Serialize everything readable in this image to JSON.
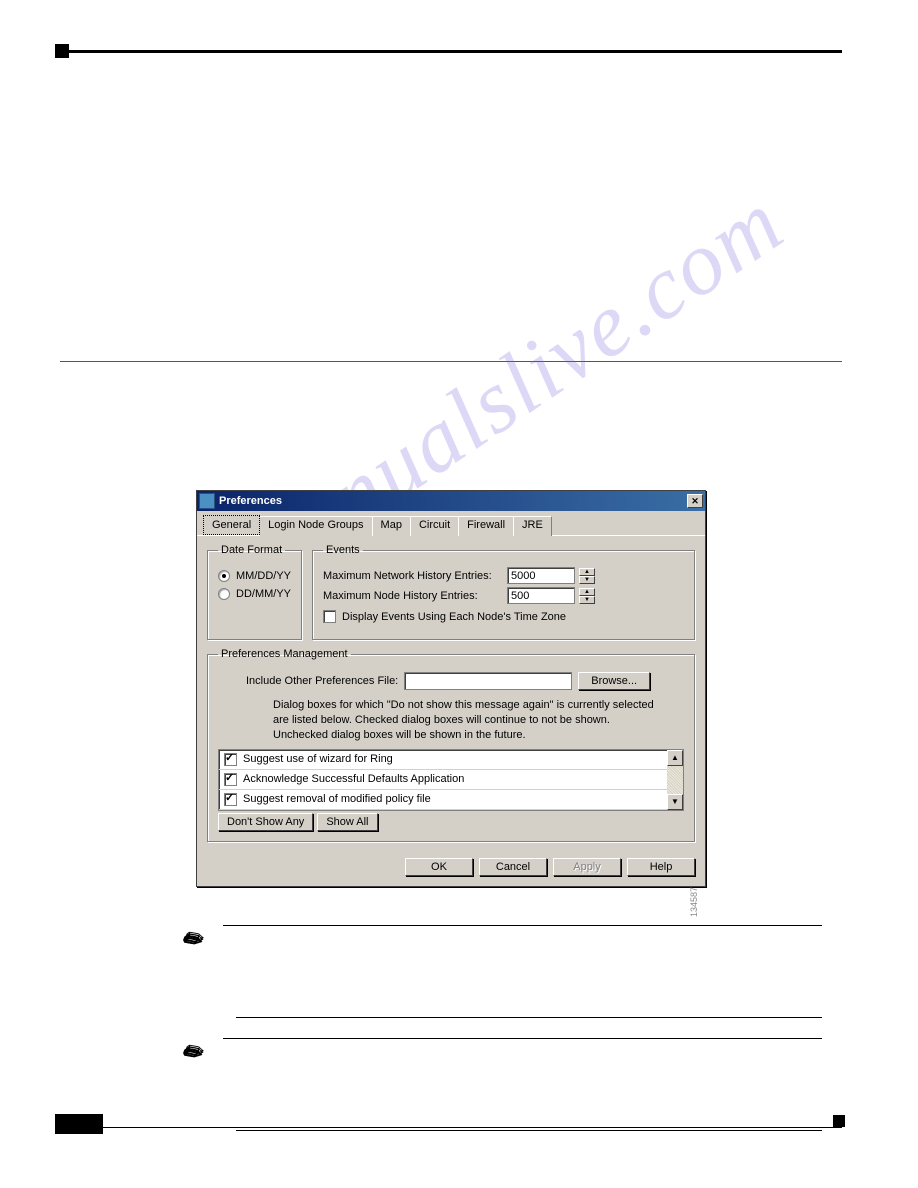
{
  "dialog": {
    "title": "Preferences",
    "tabs": [
      "General",
      "Login Node Groups",
      "Map",
      "Circuit",
      "Firewall",
      "JRE"
    ],
    "date_format": {
      "legend": "Date Format",
      "options": [
        "MM/DD/YY",
        "DD/MM/YY"
      ],
      "selected_index": 0
    },
    "events": {
      "legend": "Events",
      "rows": [
        {
          "label": "Maximum Network History Entries:",
          "value": "5000"
        },
        {
          "label": "Maximum Node History Entries:",
          "value": "500"
        }
      ],
      "checkbox_label": "Display Events Using Each Node's Time Zone",
      "checkbox_checked": false
    },
    "prefs_mgmt": {
      "legend": "Preferences Management",
      "include_label": "Include Other Preferences File:",
      "include_value": "",
      "browse_label": "Browse...",
      "info_lines": [
        "Dialog boxes for which \"Do not show this message again\" is currently selected",
        "are listed below. Checked dialog boxes will continue to not be shown.",
        "Unchecked dialog boxes will be shown in the future."
      ],
      "items": [
        {
          "label": "Suggest use of wizard for Ring",
          "checked": true
        },
        {
          "label": "Acknowledge Successful Defaults Application",
          "checked": true
        },
        {
          "label": "Suggest removal of modified policy file",
          "checked": true
        }
      ],
      "dont_show_label": "Don't Show Any",
      "show_all_label": "Show All"
    },
    "buttons": {
      "ok": "OK",
      "cancel": "Cancel",
      "apply": "Apply",
      "help": "Help"
    },
    "image_ref": "134587"
  },
  "watermark": "manualslive.com"
}
